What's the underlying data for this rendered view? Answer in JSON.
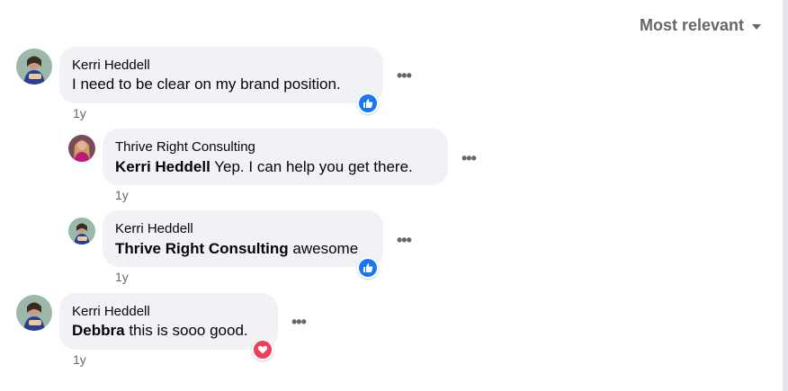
{
  "sort": {
    "label": "Most relevant"
  },
  "comments": [
    {
      "author": "Kerri Heddell",
      "mention": "",
      "text": "I need to be clear on my brand position.",
      "time": "1y",
      "reaction": "like"
    },
    {
      "author": "Thrive Right Consulting",
      "mention": "Kerri Heddell",
      "text": "Yep. I can help you get there.",
      "time": "1y",
      "reaction": ""
    },
    {
      "author": "Kerri Heddell",
      "mention": "Thrive Right Consulting",
      "text": "awesome",
      "time": "1y",
      "reaction": "like"
    },
    {
      "author": "Kerri Heddell",
      "mention": "Debbra",
      "text": "this is sooo good.",
      "time": "1y",
      "reaction": "love"
    }
  ],
  "more_label": "•••",
  "colors": {
    "like": "#1877f2",
    "love": "#f33e58",
    "bubble": "#f0f2f5",
    "meta": "#65676b"
  }
}
